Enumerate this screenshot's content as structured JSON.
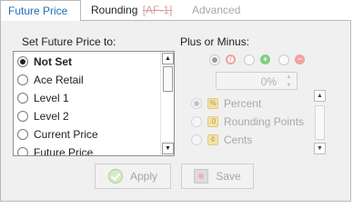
{
  "tabs": {
    "future_price": "Future Price",
    "rounding": "Rounding",
    "rounding_tag": "[AF-1]",
    "advanced": "Advanced"
  },
  "left": {
    "label": "Set Future Price to:",
    "items": [
      {
        "label": "Not Set",
        "selected": true
      },
      {
        "label": "Ace Retail",
        "selected": false
      },
      {
        "label": "Level 1",
        "selected": false
      },
      {
        "label": "Level 2",
        "selected": false
      },
      {
        "label": "Current Price",
        "selected": false
      },
      {
        "label": "Future Price",
        "selected": false
      }
    ]
  },
  "right": {
    "label": "Plus or Minus:",
    "amount": "0%",
    "options": [
      {
        "label": "Percent",
        "selected": true
      },
      {
        "label": "Rounding Points",
        "selected": false
      },
      {
        "label": "Cents",
        "selected": false
      }
    ]
  },
  "buttons": {
    "apply": "Apply",
    "save": "Save"
  },
  "colors": {
    "active_tab": "#1f6fb8",
    "panel_bg": "#f0f0f0",
    "plus_green": "#7fcf7f",
    "minus_red": "#f1a0a0",
    "none_red": "#f0a0a0"
  }
}
